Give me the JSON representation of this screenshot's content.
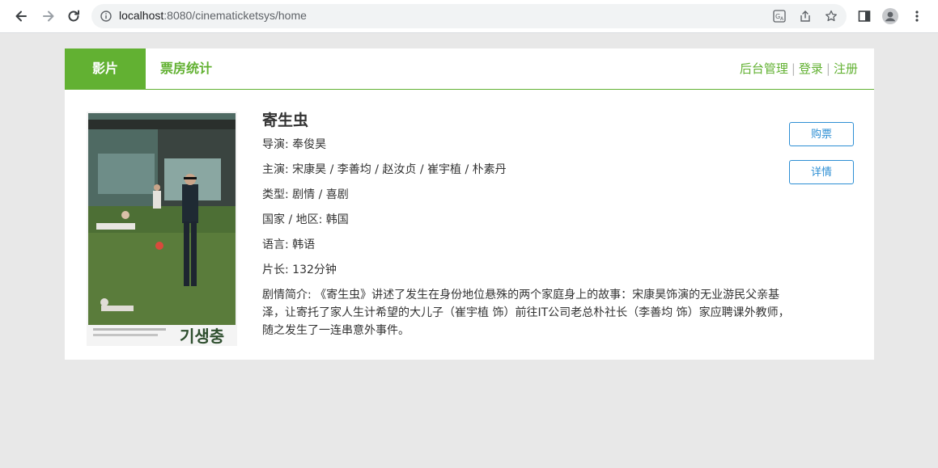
{
  "browser": {
    "url_host": "localhost",
    "url_rest": ":8080/cinematicketsys/home"
  },
  "nav": {
    "tabs": [
      {
        "label": "影片"
      },
      {
        "label": "票房统计"
      }
    ],
    "links": [
      {
        "label": "后台管理"
      },
      {
        "label": "登录"
      },
      {
        "label": "注册"
      }
    ],
    "separator": "|"
  },
  "movie": {
    "title": "寄生虫",
    "director": "导演: 奉俊昊",
    "cast": "主演: 宋康昊 / 李善均 / 赵汝贞 / 崔宇植 / 朴素丹",
    "genre": "类型: 剧情 / 喜剧",
    "country": "国家 / 地区: 韩国",
    "language": "语言: 韩语",
    "duration": "片长: 132分钟",
    "summary": "剧情简介: 《寄生虫》讲述了发生在身份地位悬殊的两个家庭身上的故事：宋康昊饰演的无业游民父亲基泽，让寄托了家人生计希望的大儿子（崔宇植 饰）前往IT公司老总朴社长（李善均 饰）家应聘课外教师，随之发生了一连串意外事件。",
    "poster_title_text": "기생충",
    "buy_button": "购票",
    "detail_button": "详情"
  },
  "colors": {
    "accent_green": "#62b132",
    "button_blue": "#2e8fd4",
    "page_bg": "#e8e8e8"
  }
}
